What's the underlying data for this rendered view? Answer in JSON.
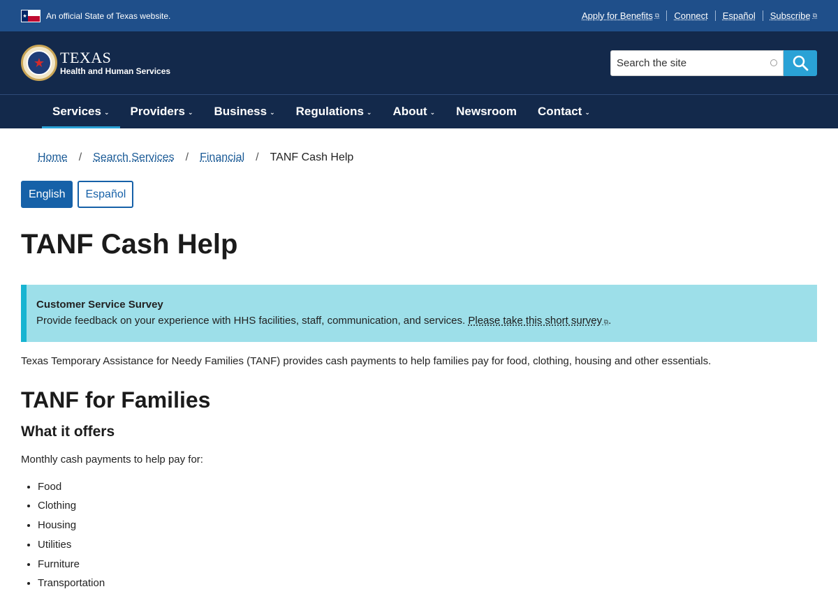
{
  "official_bar": {
    "text": "An official State of Texas website.",
    "links": [
      {
        "label": "Apply for Benefits",
        "external": true
      },
      {
        "label": "Connect",
        "external": false
      },
      {
        "label": "Español",
        "external": false
      },
      {
        "label": "Subscribe",
        "external": true
      }
    ]
  },
  "logo": {
    "line1": "TEXAS",
    "line2": "Health and Human Services"
  },
  "search": {
    "placeholder": "Search the site"
  },
  "nav": {
    "items": [
      {
        "label": "Services",
        "dropdown": true,
        "active": true
      },
      {
        "label": "Providers",
        "dropdown": true
      },
      {
        "label": "Business",
        "dropdown": true
      },
      {
        "label": "Regulations",
        "dropdown": true
      },
      {
        "label": "About",
        "dropdown": true
      },
      {
        "label": "Newsroom",
        "dropdown": false
      },
      {
        "label": "Contact",
        "dropdown": true
      }
    ]
  },
  "breadcrumb": {
    "items": [
      "Home",
      "Search Services",
      "Financial"
    ],
    "current": "TANF Cash Help"
  },
  "language": {
    "english": "English",
    "spanish": "Español"
  },
  "page": {
    "title": "TANF Cash Help"
  },
  "alert": {
    "title": "Customer Service Survey",
    "text": "Provide feedback on your experience with HHS facilities, staff, communication, and services.",
    "link": "Please take this short survey",
    "suffix": "."
  },
  "intro": "Texas Temporary Assistance for Needy Families (TANF) provides cash payments to help families pay for food, clothing, housing and other essentials.",
  "section": {
    "title": "TANF for Families",
    "subtitle": "What it offers",
    "offers_intro": "Monthly cash payments to help pay for:",
    "offers": [
      "Food",
      "Clothing",
      "Housing",
      "Utilities",
      "Furniture",
      "Transportation"
    ]
  },
  "colors": {
    "banner": "#1f4f8a",
    "header": "#13294b",
    "accent": "#2aa2d6",
    "alert_bg": "#9ddfe9",
    "link": "#1a5a96"
  },
  "icons": {
    "flag": "texas-flag-icon",
    "search": "search-icon",
    "external": "external-link-icon",
    "chevron": "chevron-down-icon"
  }
}
